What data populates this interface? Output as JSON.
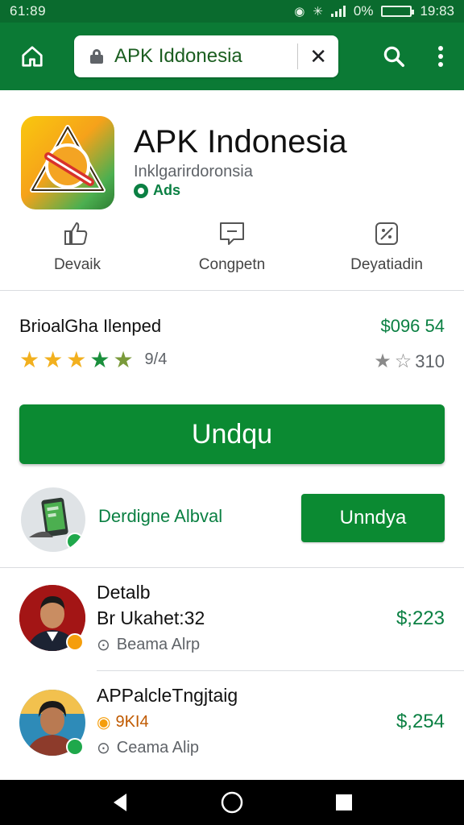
{
  "status_bar": {
    "time_left": "61:89",
    "battery_pct": "0%",
    "time_right": "19:83"
  },
  "browser": {
    "url": "APK Iddonesia",
    "icons": {
      "home": "home-icon",
      "lock": "lock-icon",
      "clear": "close-icon",
      "search": "search-icon",
      "menu": "more-vert-icon"
    }
  },
  "app": {
    "title": "APK Indonesia",
    "developer": "Inklgarirdoronsia",
    "tag": "Ads",
    "actions": [
      {
        "label": "Devaik",
        "icon": "like-icon"
      },
      {
        "label": "Congpetn",
        "icon": "message-icon"
      },
      {
        "label": "Deyatiadin",
        "icon": "share-icon"
      }
    ]
  },
  "rating": {
    "title": "BrioalGha Ilenped",
    "price": "$096 54",
    "stars": 4.5,
    "count": "9/4",
    "right_value": "310"
  },
  "download_button": "Undqu",
  "promo": {
    "label": "Derdigne Albval",
    "button": "Unndya"
  },
  "list": [
    {
      "title": "Detalb",
      "subtitle": "Br Ukahet:32",
      "location": "Beama Alrp",
      "price": "$;223"
    },
    {
      "title": "APPalcleTngjtaig",
      "subtitle": "9KI4",
      "location": "Ceama Alip",
      "price": "$,254"
    }
  ],
  "colors": {
    "primary": "#0b7a35",
    "accent": "#0b8a32",
    "price": "#0b8043",
    "star": "#f2b01e"
  }
}
